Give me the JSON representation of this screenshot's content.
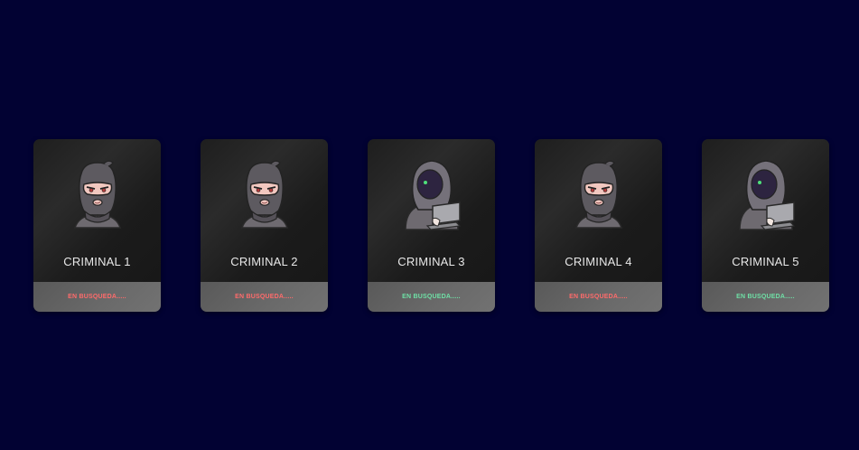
{
  "colors": {
    "background": "#020233",
    "status_red": "#ff6b6b",
    "status_green": "#6fe0a6"
  },
  "cards": [
    {
      "name": "CRIMINAL 1",
      "status": "EN BUSQUEDA.....",
      "status_color": "#ff6b6b",
      "icon": "masked-robber-icon"
    },
    {
      "name": "CRIMINAL 2",
      "status": "EN BUSQUEDA.....",
      "status_color": "#ff6b6b",
      "icon": "masked-robber-icon"
    },
    {
      "name": "CRIMINAL 3",
      "status": "EN BUSQUEDA.....",
      "status_color": "#6fe0a6",
      "icon": "hooded-hacker-icon"
    },
    {
      "name": "CRIMINAL 4",
      "status": "EN BUSQUEDA.....",
      "status_color": "#ff6b6b",
      "icon": "masked-robber-icon"
    },
    {
      "name": "CRIMINAL 5",
      "status": "EN BUSQUEDA.....",
      "status_color": "#6fe0a6",
      "icon": "hooded-hacker-icon"
    }
  ]
}
